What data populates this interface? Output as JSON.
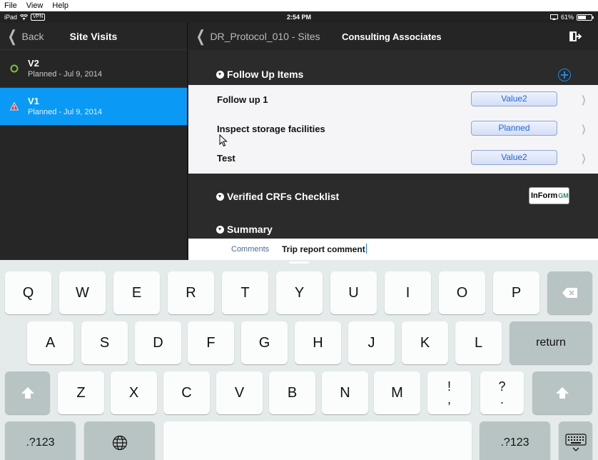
{
  "menubar": {
    "items": [
      "File",
      "View",
      "Help"
    ]
  },
  "statusbar": {
    "device": "iPad",
    "vpn": "VPN",
    "time": "2:54 PM",
    "battery": "61%",
    "battery_level": 0.61
  },
  "master": {
    "back_label": "Back",
    "title": "Site Visits",
    "visits": [
      {
        "name": "V2",
        "subtitle": "Planned - Jul 9, 2014",
        "status_icon": "circle-ok-icon",
        "selected": false
      },
      {
        "name": "V1",
        "subtitle": "Planned - Jul 9, 2014",
        "status_icon": "warning-icon",
        "selected": true
      }
    ]
  },
  "detail": {
    "back_label": "DR_Protocol_010 - Sites",
    "title": "Consulting Associates",
    "followup": {
      "header": "Follow Up Items",
      "items": [
        {
          "label": "Follow up 1",
          "value": "Value2"
        },
        {
          "label": "Inspect storage facilities",
          "value": "Planned"
        },
        {
          "label": "Test",
          "value": "Value2"
        }
      ]
    },
    "crf_header": "Verified CRFs Checklist",
    "inform_logo": {
      "text": "InForm",
      "suffix": "GM"
    },
    "summary_header": "Summary",
    "comment": {
      "label": "Comments",
      "value": "Trip report comment"
    }
  },
  "keyboard": {
    "row1": [
      "Q",
      "W",
      "E",
      "R",
      "T",
      "Y",
      "U",
      "I",
      "O",
      "P"
    ],
    "row2": [
      "A",
      "S",
      "D",
      "F",
      "G",
      "H",
      "J",
      "K",
      "L"
    ],
    "return_label": "return",
    "row3": [
      "Z",
      "X",
      "C",
      "V",
      "B",
      "N",
      "M"
    ],
    "exclaim": [
      "!",
      ","
    ],
    "question": [
      "?",
      "."
    ],
    "numbers_label": ".?123"
  },
  "colors": {
    "selection": "#0a9af5",
    "accent": "#1e88e5",
    "value_text": "#1f66d6"
  }
}
